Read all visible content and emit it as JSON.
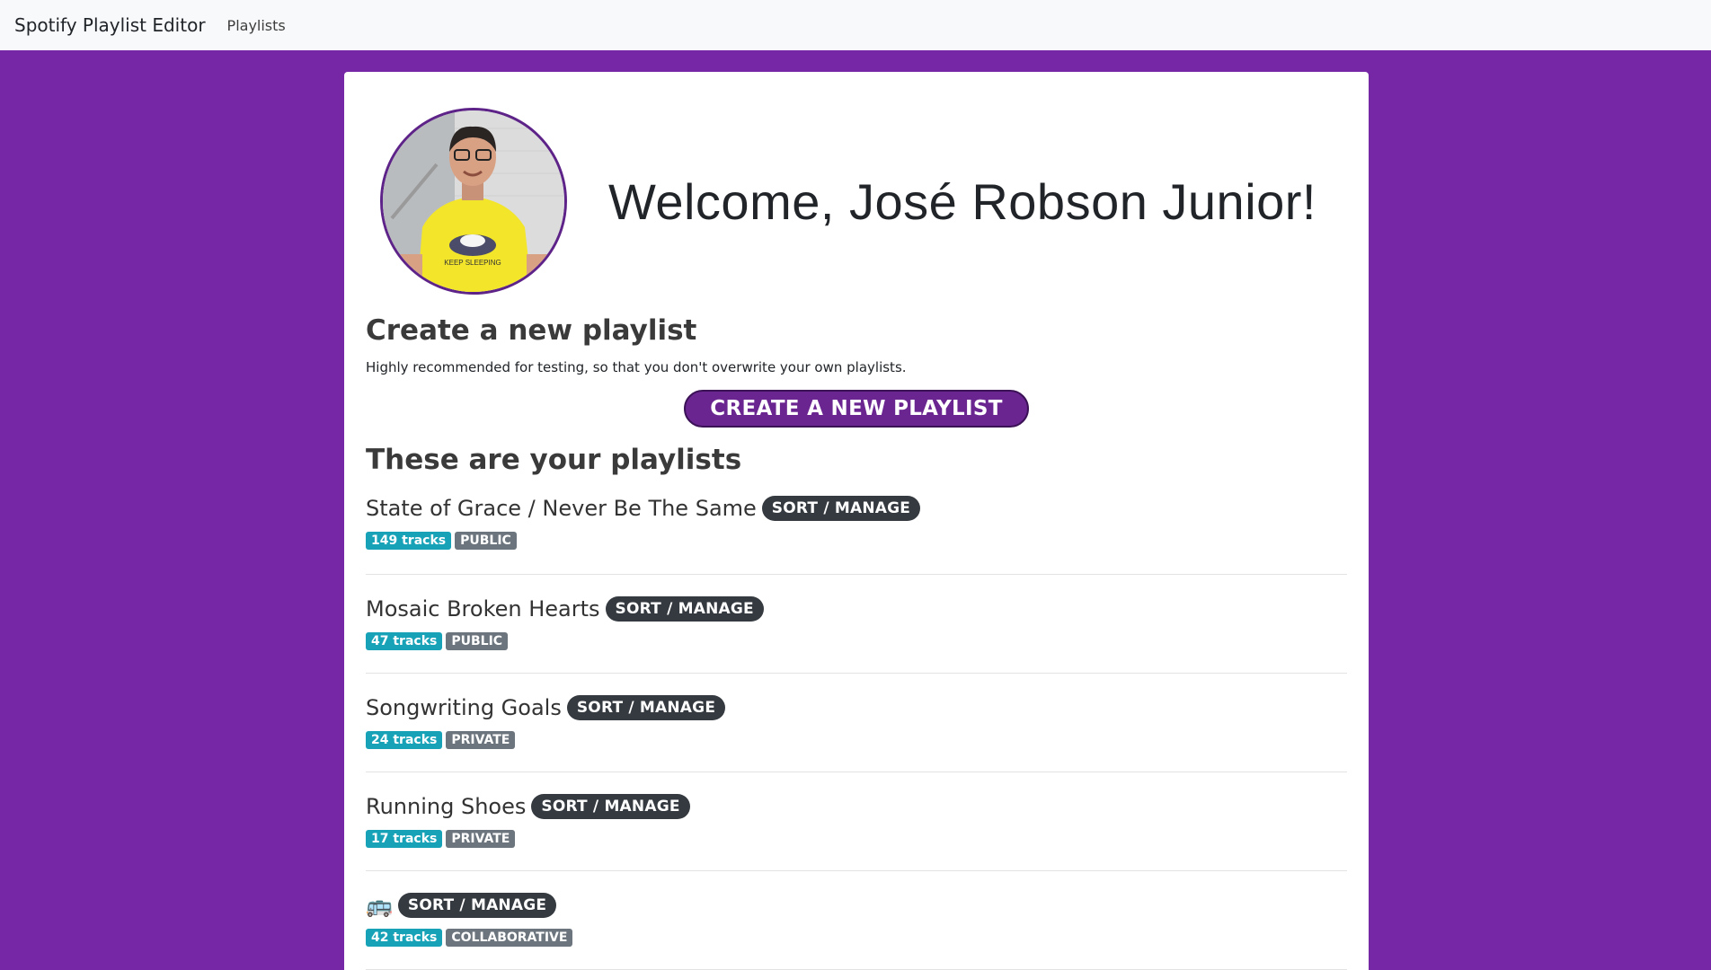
{
  "navbar": {
    "brand": "Spotify Playlist Editor",
    "links": [
      "Playlists"
    ]
  },
  "profile": {
    "welcome": "Welcome, José Robson Junior!",
    "avatar_shirt_text": "KEEP SLEEPING"
  },
  "create": {
    "title": "Create a new playlist",
    "subtitle": "Highly recommended for testing, so that you don't overwrite your own playlists.",
    "button": "CREATE A NEW PLAYLIST"
  },
  "playlists_section": {
    "title": "These are your playlists",
    "sort_label": "SORT / MANAGE",
    "items": [
      {
        "name": "State of Grace / Never Be The Same",
        "tracks": "149 tracks",
        "visibility": "PUBLIC"
      },
      {
        "name": "Mosaic Broken Hearts",
        "tracks": "47 tracks",
        "visibility": "PUBLIC"
      },
      {
        "name": "Songwriting Goals",
        "tracks": "24 tracks",
        "visibility": "PRIVATE"
      },
      {
        "name": "Running Shoes",
        "tracks": "17 tracks",
        "visibility": "PRIVATE"
      },
      {
        "name": "🚌",
        "tracks": "42 tracks",
        "visibility": "COLLABORATIVE"
      }
    ]
  },
  "colors": {
    "background": "#7627a6",
    "button": "#6a2591",
    "tracks_badge": "#17a2b8",
    "visibility_badge": "#6c757d",
    "sort_badge": "#343a40"
  }
}
